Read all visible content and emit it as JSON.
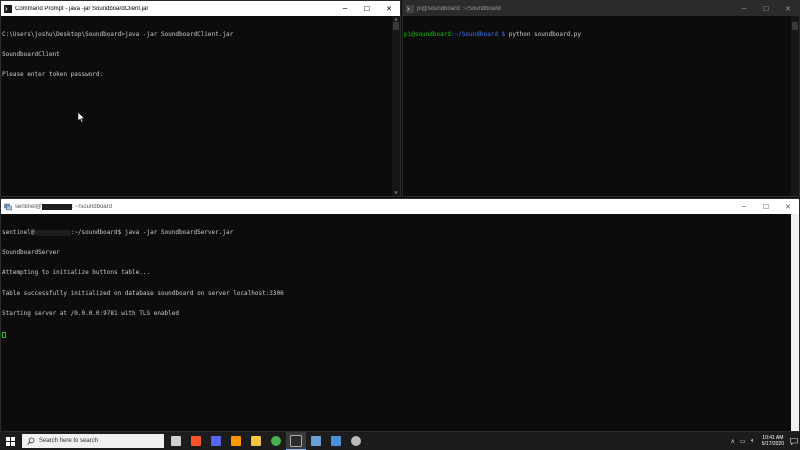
{
  "windows": {
    "cmd": {
      "title": "Command Prompt - java -jar SoundboardClient.jar",
      "lines": [
        "C:\\Users\\joshu\\Desktop\\Soundboard>java -jar SoundboardClient.jar",
        "SoundboardClient",
        "Please enter token password:"
      ]
    },
    "pi": {
      "title": "pi@soundboard: ~/Soundboard",
      "prompt_user": "pi@soundboard",
      "prompt_path": ":~/Soundboard $",
      "command": " python soundboard.py"
    },
    "server": {
      "title_prefix": "sentinel@",
      "title_suffix": ": ~/soundboard",
      "prompt_user": "sentinel@",
      "prompt_path": ":~/soundboard$",
      "command": " java -jar SoundboardServer.jar",
      "lines": [
        "SoundboardServer",
        "Attempting to initialize buttons table...",
        "Table successfully initialized on database soundboard on server localhost:3306",
        "Starting server at /0.0.0.0:9781 with TLS enabled"
      ]
    }
  },
  "taskbar": {
    "search_placeholder": "Search here to search",
    "apps": [
      {
        "icon": "task-view-icon",
        "color": "#cfcfcf"
      },
      {
        "icon": "brave-icon",
        "color": "#fb542b"
      },
      {
        "icon": "discord-icon",
        "color": "#5865f2"
      },
      {
        "icon": "sublime-icon",
        "color": "#ff9800"
      },
      {
        "icon": "file-explorer-icon",
        "color": "#f4c542"
      },
      {
        "icon": "chrome-icon",
        "color": "#4caf50"
      },
      {
        "icon": "terminal-icon",
        "color": "#2b2b2b"
      },
      {
        "icon": "putty-icon",
        "color": "#6aa0d8"
      },
      {
        "icon": "shield-icon",
        "color": "#4a90d9"
      },
      {
        "icon": "settings-icon",
        "color": "#bbbbbb"
      }
    ],
    "time": "10:41 AM",
    "date": "5/17/2020"
  }
}
